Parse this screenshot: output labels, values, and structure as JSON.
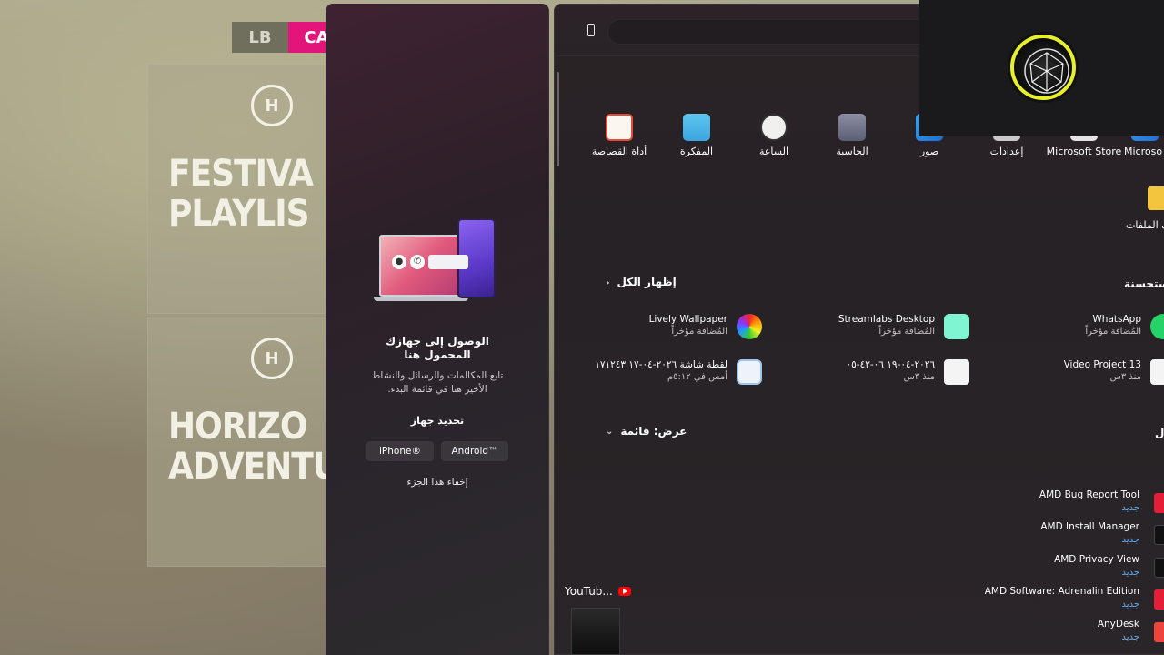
{
  "game": {
    "tabs": [
      "LB",
      "CA"
    ],
    "tiles": [
      {
        "icon": "H",
        "title": "FESTIVA\nPLAYLIS"
      },
      {
        "icon": "H",
        "title": "HORIZO\nADVENTU"
      }
    ]
  },
  "phone_panel": {
    "title_line1": "الوصول إلى جهازك",
    "title_line2": "المحمول هنا",
    "desc_line1": "تابع المكالمات والرسائل والنشاط",
    "desc_line2": "الأخير هنا في قائمة البدء.",
    "choose_device": "تحديد جهاز",
    "iphone_label": "iPhone®",
    "android_label": "Android™",
    "hide_label": "إخفاء هذا الجزء"
  },
  "start_menu": {
    "pinned": [
      {
        "label": "أداة القصاصة",
        "icon": "snipping-tool-icon"
      },
      {
        "label": "المفكرة",
        "icon": "notepad-icon"
      },
      {
        "label": "الساعة",
        "icon": "clock-icon"
      },
      {
        "label": "الحاسبة",
        "icon": "calculator-icon"
      },
      {
        "label": "صور",
        "icon": "photos-icon"
      },
      {
        "label": "إعدادات",
        "icon": "settings-icon"
      },
      {
        "label": "Microsoft Store",
        "icon": "store-icon"
      },
      {
        "label": "Microso",
        "icon": "microsoft-icon"
      }
    ],
    "files_label": "ف الملفات",
    "show_all": "إظهار الكل",
    "recommended_header": "ستحسنة",
    "recommended": [
      {
        "name": "Lively Wallpaper",
        "sub": "المُضافة مؤخراً"
      },
      {
        "name": "Streamlabs Desktop",
        "sub": "المُضافة مؤخراً"
      },
      {
        "name": "WhatsApp",
        "sub": "المُضافة مؤخراً"
      },
      {
        "name": "لقطة شاشة ٢٠٢٦-٠٤-١٧ ١٧١٢٤٣",
        "sub": "أمس في ٥:١٢م"
      },
      {
        "name": "٢٠٢٦-٠٤-١٩ ٠٦-٤٢-٠٥",
        "sub": "منذ ٣س"
      },
      {
        "name": "Video Project 13",
        "sub": "منذ ٣س"
      }
    ],
    "view_label": "عرض: قائمة",
    "all_header": "ل",
    "apps": [
      {
        "name": "AMD Bug Report Tool",
        "badge": "جديد"
      },
      {
        "name": "AMD Install Manager",
        "badge": "جديد"
      },
      {
        "name": "AMD Privacy View",
        "badge": "جديد"
      },
      {
        "name": "AMD Software: Adrenalin Edition",
        "badge": "جديد"
      },
      {
        "name": "AnyDesk",
        "badge": "جديد"
      }
    ]
  },
  "taskbar_preview": {
    "label": "YouTub..."
  },
  "colors": {
    "accent_pink": "#e4157a",
    "link_blue": "#5fb0ff",
    "cam_ring": "#e8ef2b"
  }
}
